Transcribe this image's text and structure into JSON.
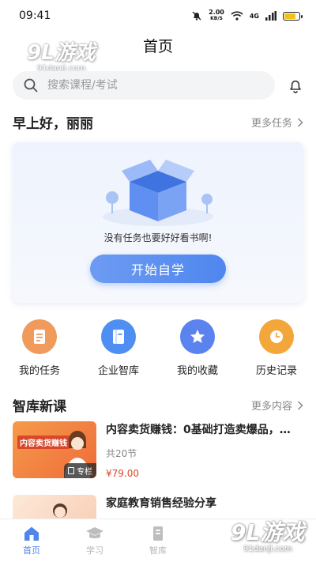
{
  "status_bar": {
    "time": "09:41",
    "net_speed_value": "2.00",
    "net_speed_unit": "KB/S",
    "network": "4G",
    "battery_level": 0.75
  },
  "watermark": {
    "brand": "9L游戏",
    "site": "91danji.com"
  },
  "nav": {
    "title": "首页"
  },
  "search": {
    "placeholder": "搜索课程/考试"
  },
  "tasks": {
    "greeting": "早上好，丽丽",
    "more_label": "更多任务",
    "empty_text": "没有任务也要好好看书啊!",
    "start_button": "开始自学"
  },
  "quick_actions": [
    {
      "label": "我的任务",
      "icon": "task-list-icon",
      "color": "#f09a5c"
    },
    {
      "label": "企业智库",
      "icon": "book-icon",
      "color": "#4f8ef2"
    },
    {
      "label": "我的收藏",
      "icon": "star-icon",
      "color": "#5b83f0"
    },
    {
      "label": "历史记录",
      "icon": "clock-icon",
      "color": "#f3a63a"
    }
  ],
  "new_courses": {
    "title": "智库新课",
    "more_label": "更多内容",
    "items": [
      {
        "title": "内容卖货赚钱：0基础打造卖爆品，…",
        "lessons": "共20节",
        "price": "¥79.00",
        "badge": "专栏",
        "thumb_text": "内容卖货赚钱"
      },
      {
        "title": "家庭教育销售经验分享"
      }
    ]
  },
  "tabbar": [
    {
      "label": "首页",
      "icon": "home-icon",
      "active": true
    },
    {
      "label": "学习",
      "icon": "graduation-cap-icon",
      "active": false
    },
    {
      "label": "智库",
      "icon": "library-icon",
      "active": false
    }
  ],
  "colors": {
    "accent": "#4f86ee",
    "price": "#e0452a"
  }
}
